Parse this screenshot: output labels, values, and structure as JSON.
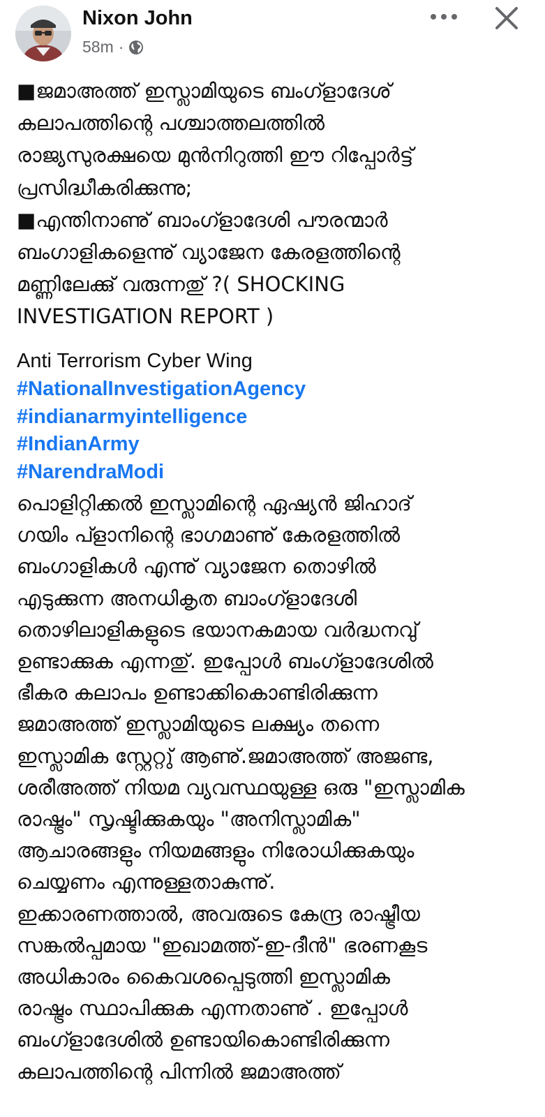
{
  "post": {
    "author": "Nixon John",
    "time": "58m",
    "separator": "·",
    "privacy_icon": "globe-icon",
    "more_icon": "more-horizontal-icon",
    "close_icon": "close-icon",
    "intro_lines": [
      "■ജമാഅത്ത് ഇസ്ലാമിയുടെ ബംഗ്ളാദേശ്",
      "കലാപത്തിന്റെ  പശ്ചാത്തലത്തിൽ",
      "രാജ്യസുരക്ഷയെ മുൻനിറുത്തി ഈ റിപ്പോർട്ട്",
      "പ്രസിദ്ധീകരിക്കുന്നു;",
      "■എന്തിനാണു് ബാംഗ്ളാദേശി പൗരന്മാർ",
      "ബംഗാളികളെന്നു് വ്യാജേന കേരളത്തിന്റെ",
      "മണ്ണിലേക്കു് വരുന്നതു് ?( SHOCKING",
      "INVESTIGATION REPORT )"
    ],
    "signature": "Anti Terrorism Cyber Wing",
    "hashtags": [
      "#NationalInvestigationAgency",
      "#indianarmyintelligence",
      "#IndianArmy",
      "#NarendraModi"
    ],
    "body_lines": [
      "    പൊളിറ്റിക്കൽ ഇസ്ലാമിന്റെ ഏഷ്യൻ ജിഹാദ്",
      "ഗയിം പ്ളാനിന്റെ ഭാഗമാണു് കേരളത്തിൽ",
      "ബംഗാളികൾ എന്നു് വ്യാജേന തൊഴിൽ",
      "എടുക്കുന്ന അനധികൃത ബാംഗ്ളാദേശി",
      "തൊഴിലാളികളുടെ  ഭയാനകമായ വർദ്ധനവു്",
      "ഉണ്ടാക്കുക എന്നതു്. ഇപ്പോൾ ബംഗ്ളാദേശിൽ",
      "ഭീകര കലാപം ഉണ്ടാക്കികൊണ്ടിരിക്കുന്ന",
      "ജമാഅത്ത് ഇസ്ലാമിയുടെ ലക്ഷ്യം തന്നെ",
      "ഇസ്ലാമിക സ്റ്റേറ്റു് ആണു്.ജമാഅത്ത് അജണ്ട,",
      "ശരീഅത്ത് നിയമ വ്യവസ്ഥയുള്ള ഒരു \"ഇസ്ലാമിക",
      "രാഷ്ട്രം\" സൃഷ്ടിക്കുകയും \"അനിസ്ലാമിക\"",
      "ആചാരങ്ങളും നിയമങ്ങളും നിരോധിക്കുകയും",
      "ചെയ്യണം എന്നുള്ളതാകുന്നു്.",
      "ഇക്കാരണത്താൽ, അവരുടെ കേന്ദ്ര രാഷ്ട്രീയ",
      "സങ്കൽപ്പമായ \"ഇഖാമത്ത്-ഇ-ദീൻ\" ഭരണകൂട",
      "അധികാരം കൈവശപ്പെടുത്തി ഇസ്ലാമിക",
      "രാഷ്ട്രം സ്ഥാപിക്കുക എന്നതാണു് . ഇപ്പോൾ",
      "ബംഗ്ളാദേശിൽ ഉണ്ടായികൊണ്ടിരിക്കുന്ന",
      "കലാപത്തിന്റെ പിന്നിൽ ജമാഅത്ത്"
    ]
  }
}
